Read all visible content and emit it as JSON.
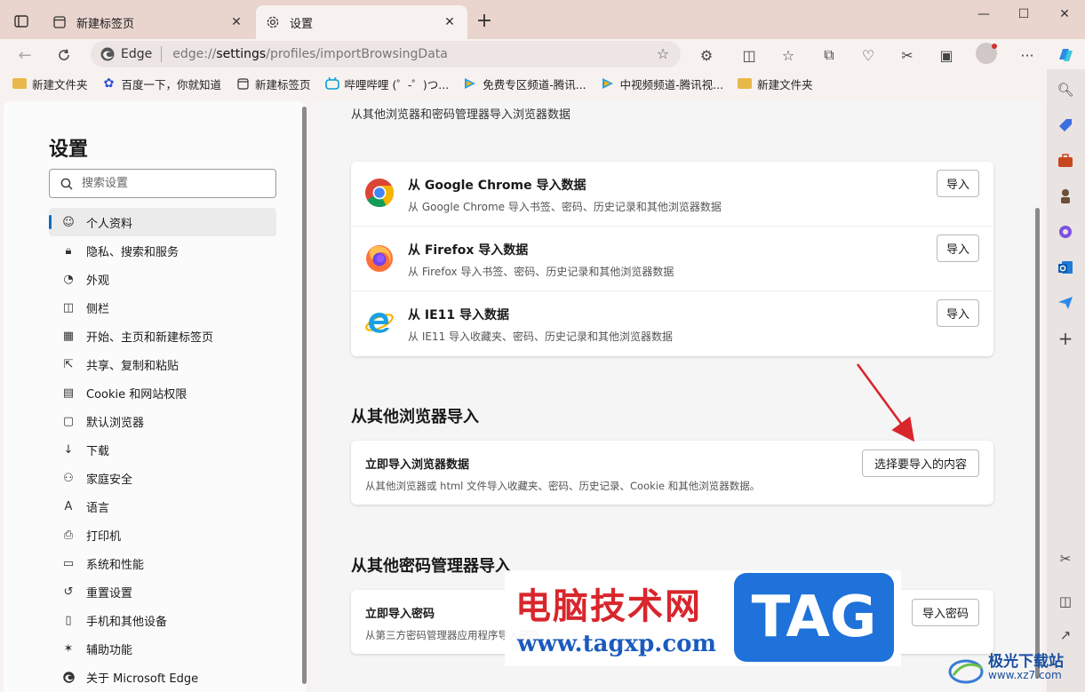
{
  "tabs": [
    {
      "title": "新建标签页",
      "active": false
    },
    {
      "title": "设置",
      "active": true
    }
  ],
  "toolbar": {
    "address_label": "Edge",
    "url_prefix": "edge://",
    "url_main": "settings",
    "url_rest": "/profiles/importBrowsingData"
  },
  "favorites": [
    {
      "label": "新建文件夹",
      "icon": "folder-icon"
    },
    {
      "label": "百度一下，你就知道",
      "icon": "baidu-icon"
    },
    {
      "label": "新建标签页",
      "icon": "newtab-icon"
    },
    {
      "label": "哔哩哔哩 (゜-゜)つ...",
      "icon": "bilibili-icon"
    },
    {
      "label": "免费专区频道-腾讯...",
      "icon": "tencent-video-icon"
    },
    {
      "label": "中视频频道-腾讯视...",
      "icon": "tencent-video-icon"
    },
    {
      "label": "新建文件夹",
      "icon": "folder-icon"
    }
  ],
  "settings_nav": {
    "title": "设置",
    "search_placeholder": "搜索设置",
    "items": [
      {
        "label": "个人资料",
        "icon": "profile-icon",
        "selected": true
      },
      {
        "label": "隐私、搜索和服务",
        "icon": "lock-icon"
      },
      {
        "label": "外观",
        "icon": "palette-icon"
      },
      {
        "label": "侧栏",
        "icon": "sidebar-icon"
      },
      {
        "label": "开始、主页和新建标签页",
        "icon": "home-icon"
      },
      {
        "label": "共享、复制和粘贴",
        "icon": "share-icon"
      },
      {
        "label": "Cookie 和网站权限",
        "icon": "cookie-icon"
      },
      {
        "label": "默认浏览器",
        "icon": "browser-icon"
      },
      {
        "label": "下载",
        "icon": "download-icon"
      },
      {
        "label": "家庭安全",
        "icon": "family-icon"
      },
      {
        "label": "语言",
        "icon": "language-icon"
      },
      {
        "label": "打印机",
        "icon": "printer-icon"
      },
      {
        "label": "系统和性能",
        "icon": "system-icon"
      },
      {
        "label": "重置设置",
        "icon": "reset-icon"
      },
      {
        "label": "手机和其他设备",
        "icon": "phone-icon"
      },
      {
        "label": "辅助功能",
        "icon": "accessibility-icon"
      },
      {
        "label": "关于 Microsoft Edge",
        "icon": "edge-icon"
      }
    ]
  },
  "main": {
    "intro": "从其他浏览器和密码管理器导入浏览器数据",
    "browsers": [
      {
        "title": "从 Google Chrome 导入数据",
        "desc": "从 Google Chrome 导入书签、密码、历史记录和其他浏览器数据",
        "button": "导入",
        "icon": "chrome-icon"
      },
      {
        "title": "从 Firefox 导入数据",
        "desc": "从 Firefox 导入书签、密码、历史记录和其他浏览器数据",
        "button": "导入",
        "icon": "firefox-icon"
      },
      {
        "title": "从 IE11 导入数据",
        "desc": "从 IE11 导入收藏夹、密码、历史记录和其他浏览器数据",
        "button": "导入",
        "icon": "ie-icon"
      }
    ],
    "other_browsers": {
      "section_title": "从其他浏览器导入",
      "title": "立即导入浏览器数据",
      "desc": "从其他浏览器或 html 文件导入收藏夹、密码、历史记录、Cookie 和其他浏览器数据。",
      "button": "选择要导入的内容"
    },
    "password_managers": {
      "section_title": "从其他密码管理器导入",
      "title": "立即导入密码",
      "desc": "从第三方密码管理器应用程序导入密码",
      "button": "导入密码"
    }
  },
  "watermark": {
    "title": "电脑技术网",
    "url": "www.tagxp.com",
    "tag": "TAG",
    "site2_title": "极光下载站",
    "site2_url": "www.xz7.com"
  }
}
